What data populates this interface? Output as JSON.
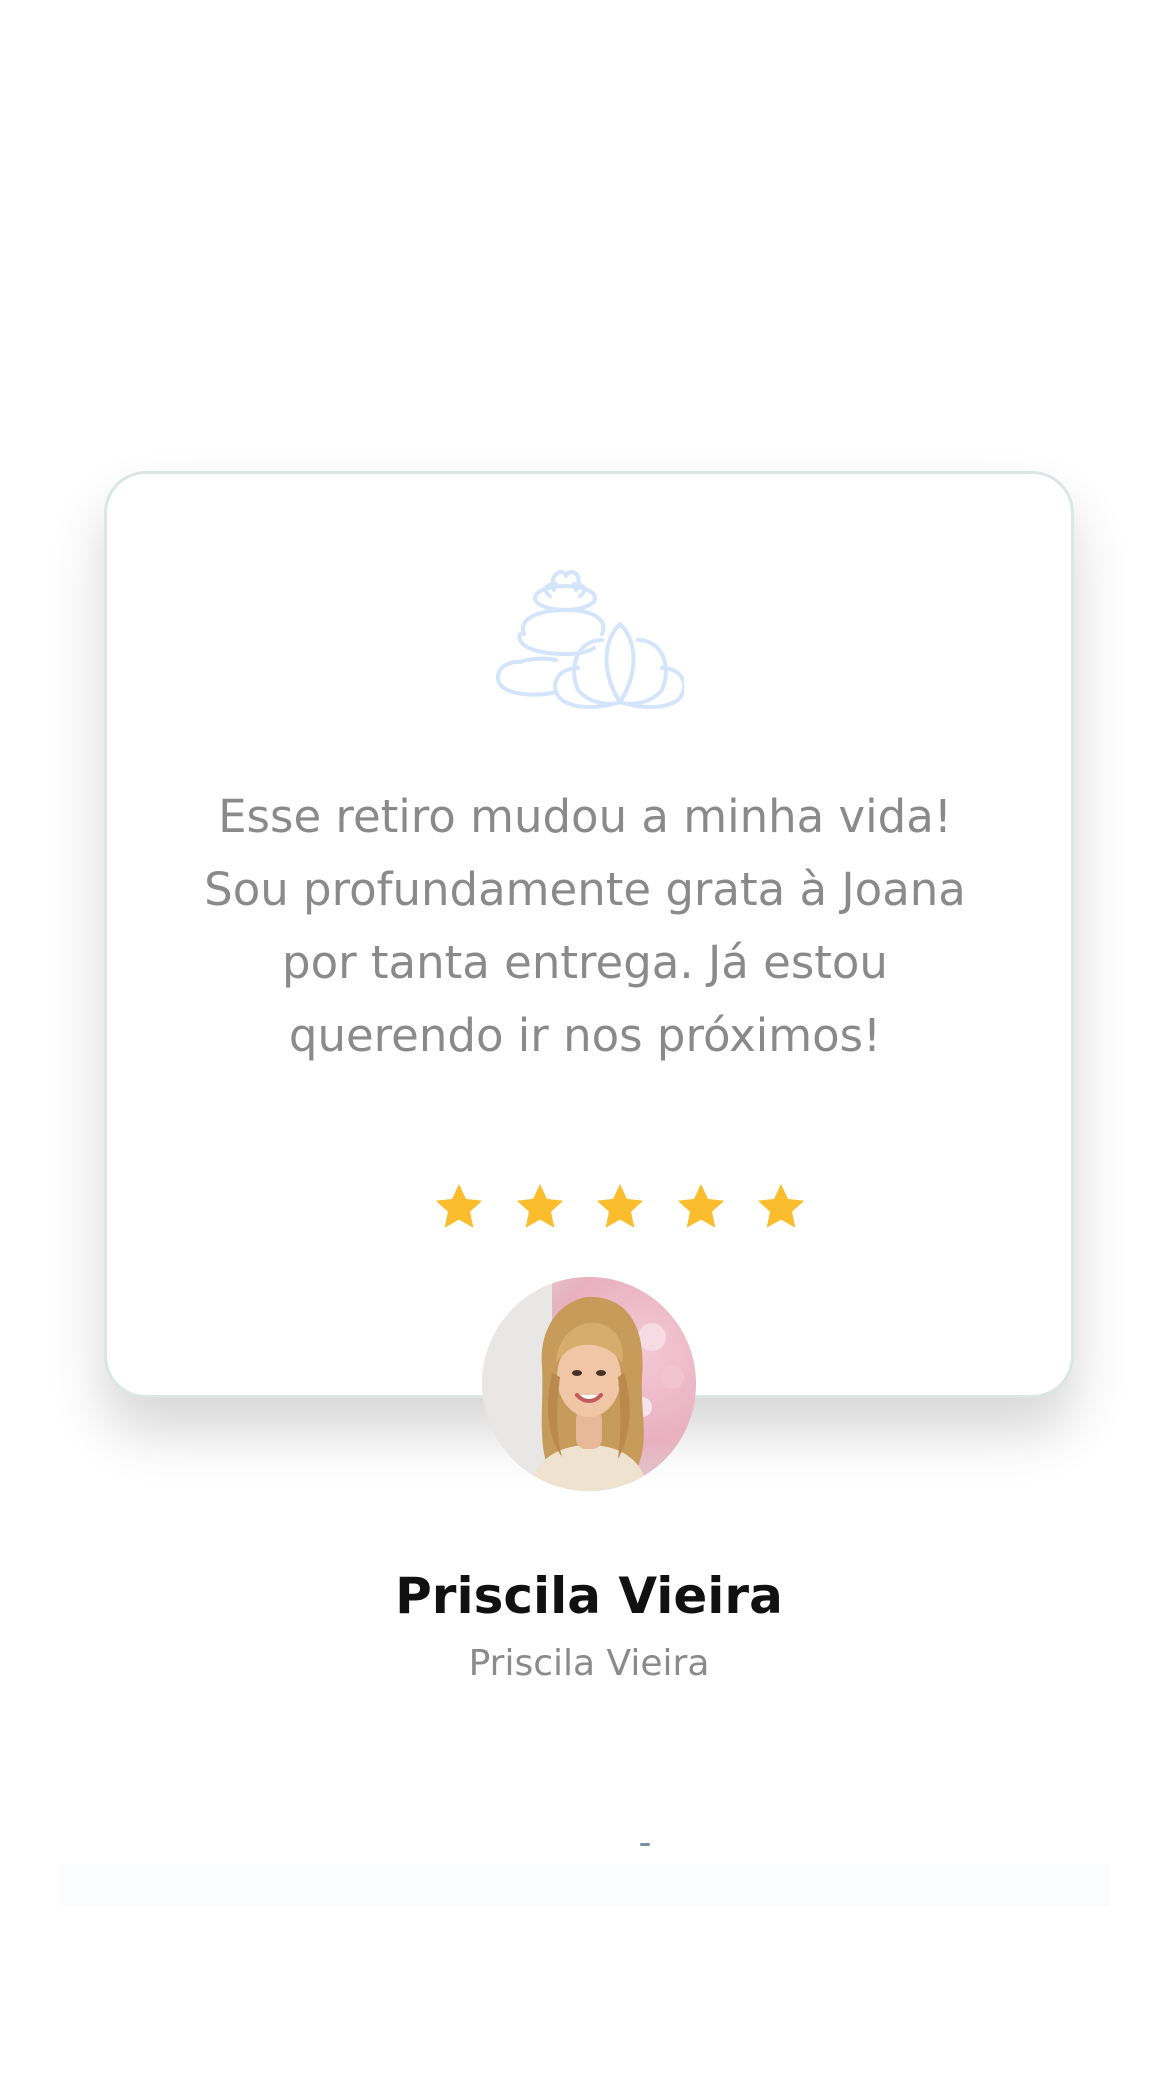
{
  "testimonial": {
    "quote": "Esse retiro mudou a minha vida! Sou profundamente grata à Joana por tanta entrega. Já estou querendo ir nos próximos!",
    "rating": 5,
    "rating_max": 5,
    "author_name": "Priscila Vieira",
    "author_role": "Priscila Vieira",
    "icon": "spa-stones-lotus-icon",
    "avatar": "avatar-photo"
  },
  "colors": {
    "star": "#fbbd2d",
    "icon_stroke": "#d3e4fb",
    "card_border": "#dbe6e5",
    "quote_text": "#8a8a8a",
    "name_text": "#111111",
    "role_text": "#8b8b8b"
  }
}
